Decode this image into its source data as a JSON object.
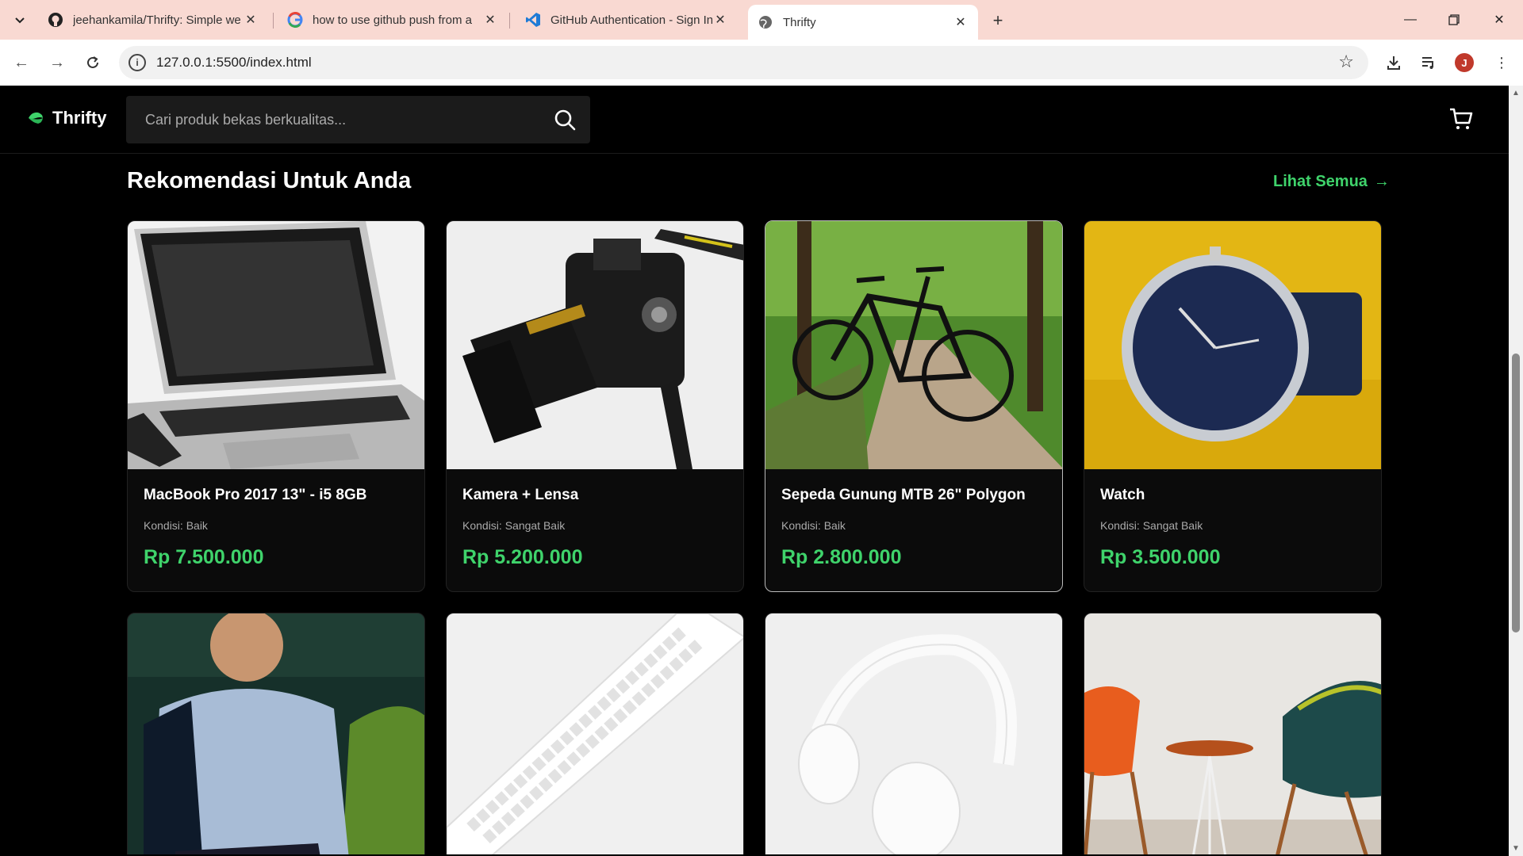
{
  "browser": {
    "tabs": [
      {
        "title": "jeehankamila/Thrifty: Simple we",
        "icon": "github-icon"
      },
      {
        "title": "how to use github push from a",
        "icon": "google-icon"
      },
      {
        "title": "GitHub Authentication - Sign In",
        "icon": "vscode-icon"
      },
      {
        "title": "Thrifty",
        "icon": "globe-icon"
      }
    ],
    "url": "127.0.0.1:5500/index.html",
    "profile_initial": "J"
  },
  "site": {
    "brand": "Thrifty",
    "search_placeholder": "Cari produk bekas berkualitas...",
    "section_title": "Rekomendasi Untuk Anda",
    "see_all": "Lihat Semua",
    "products": [
      {
        "name": "MacBook Pro 2017 13\" - i5 8GB",
        "condition": "Kondisi: Baik",
        "price": "Rp 7.500.000"
      },
      {
        "name": "Kamera + Lensa",
        "condition": "Kondisi: Sangat Baik",
        "price": "Rp 5.200.000"
      },
      {
        "name": "Sepeda Gunung MTB 26\" Polygon",
        "condition": "Kondisi: Baik",
        "price": "Rp 2.800.000"
      },
      {
        "name": "Watch",
        "condition": "Kondisi: Sangat Baik",
        "price": "Rp 3.500.000"
      }
    ]
  },
  "colors": {
    "accent": "#3fd36b",
    "tabbar": "#f9d9d2",
    "page_bg": "#000000"
  }
}
